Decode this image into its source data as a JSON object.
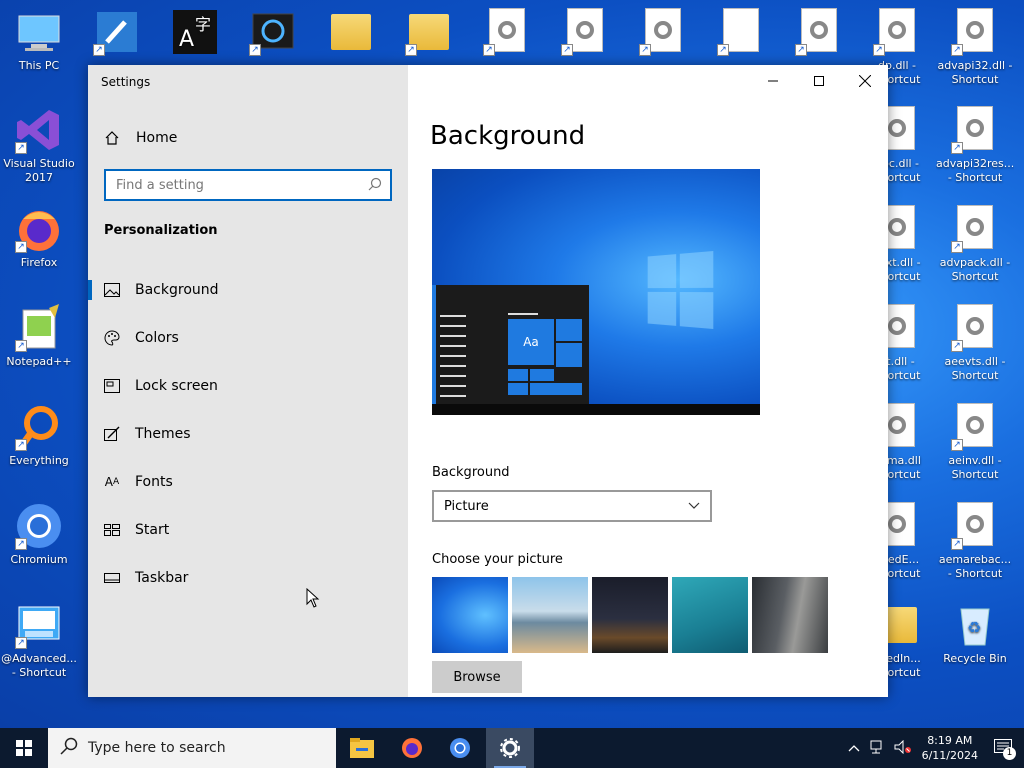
{
  "desktop": {
    "icons_left": [
      {
        "label": "This PC",
        "icon": "this-pc-icon"
      },
      {
        "label": "Visual Studio 2017",
        "icon": "visual-studio-icon"
      },
      {
        "label": "Firefox",
        "icon": "firefox-icon"
      },
      {
        "label": "Notepad++",
        "icon": "notepad-plus-icon"
      },
      {
        "label": "Everything",
        "icon": "everything-search-icon"
      },
      {
        "label": "Chromium",
        "icon": "chromium-icon"
      },
      {
        "label": "@Advanced... - Shortcut",
        "icon": "advanced-shortcut-icon"
      }
    ],
    "icons_right": [
      {
        "label": "dp.dll - Shortcut"
      },
      {
        "label": "advapi32.dll - Shortcut"
      },
      {
        "label": "dpc.dll - Shortcut"
      },
      {
        "label": "advapi32res... - Shortcut"
      },
      {
        "label": "sext.dll - Shortcut"
      },
      {
        "label": "advpack.dll - Shortcut"
      },
      {
        "label": "nt.dll - Shortcut"
      },
      {
        "label": "aeevts.dll - Shortcut"
      },
      {
        "label": "hema.dll Shortcut"
      },
      {
        "label": "aeinv.dll - Shortcut"
      },
      {
        "label": "ncedE... Shortcut"
      },
      {
        "label": "aemarebac... - Shortcut"
      },
      {
        "label": "ncedIn... Shortcut"
      },
      {
        "label": "Recycle Bin"
      }
    ]
  },
  "window": {
    "title": "Settings",
    "controls": {
      "minimize": "—",
      "maximize": "☐",
      "close": "✕"
    }
  },
  "sidebar": {
    "home_label": "Home",
    "search_placeholder": "Find a setting",
    "section_title": "Personalization",
    "items": [
      {
        "label": "Background",
        "icon": "picture-icon",
        "active": true
      },
      {
        "label": "Colors",
        "icon": "palette-icon",
        "active": false
      },
      {
        "label": "Lock screen",
        "icon": "lock-screen-icon",
        "active": false
      },
      {
        "label": "Themes",
        "icon": "themes-icon",
        "active": false
      },
      {
        "label": "Fonts",
        "icon": "fonts-icon",
        "active": false
      },
      {
        "label": "Start",
        "icon": "start-icon",
        "active": false
      },
      {
        "label": "Taskbar",
        "icon": "taskbar-icon",
        "active": false
      }
    ]
  },
  "main": {
    "heading": "Background",
    "preview_tile_text": "Aa",
    "background_label": "Background",
    "background_value": "Picture",
    "choose_label": "Choose your picture",
    "browse_label": "Browse"
  },
  "taskbar": {
    "search_placeholder": "Type here to search",
    "time": "8:19 AM",
    "date": "6/11/2024",
    "notification_count": "1"
  }
}
